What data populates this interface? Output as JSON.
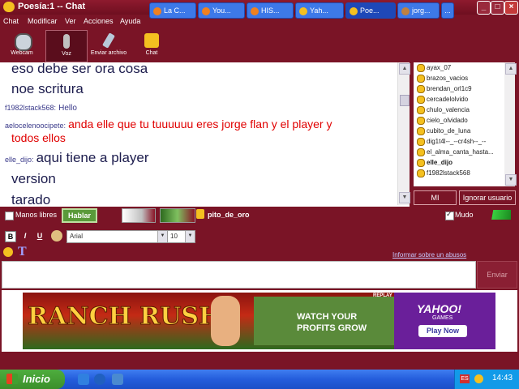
{
  "window": {
    "title": "Poesía:1 -- Chat"
  },
  "menu": [
    "Chat",
    "Modificar",
    "Ver",
    "Acciones",
    "Ayuda"
  ],
  "toolbar": {
    "webcam": "Webcam",
    "voz": "Voz",
    "enviar_archivo": "Enviar archivo",
    "chat": "Chat"
  },
  "chat": {
    "lines": [
      {
        "text": "eso debe ser ora cosa"
      },
      {
        "text": "noe scritura"
      },
      {
        "nick": "f1982lstack568:",
        "text": "Hello"
      },
      {
        "nick": "aelocelenoocipete:",
        "text": "anda elle que tu tuuuuuu eres jorge flan y el player y",
        "text2": "todos ellos"
      },
      {
        "nick": "elle_dijo:",
        "text": "aqui tiene a player"
      },
      {
        "text": "version"
      },
      {
        "text": "tarado"
      }
    ]
  },
  "users": [
    "ayax_07",
    "brazos_vacios",
    "brendan_orl1c9",
    "cercadelolvido",
    "chulo_valencia",
    "cielo_olvidado",
    "cubito_de_luna",
    "dig1t4l--_--cr4sh--_--",
    "el_alma_canta_hasta...",
    "elle_dijo",
    "f1982lstack568"
  ],
  "userlist_buttons": {
    "mi": "MI",
    "ignorar": "Ignorar usuario"
  },
  "voice": {
    "manos_libres": "Manos libres",
    "hablar": "Hablar",
    "speaker": "pito_de_oro",
    "mudo": "Mudo"
  },
  "format": {
    "bold": "B",
    "italic": "I",
    "underline": "U",
    "font": "Arial",
    "size": "10",
    "report_link": "Informar sobre un abusos"
  },
  "send": "Enviar",
  "ad": {
    "title": "RANCH RUSH",
    "tagline1": "WATCH YOUR",
    "tagline2": "PROFITS GROW",
    "replay": "REPLAY",
    "yahoo": "YAHOO!",
    "games": "GAMES",
    "play": "Play Now"
  },
  "taskbar": {
    "start": "Inicio",
    "tasks": [
      "La C...",
      "You...",
      "HIS...",
      "Yah...",
      "Poe...",
      "jorg...",
      "..."
    ],
    "lang": "ES",
    "clock": "14:43"
  },
  "colors": {
    "window_bg": "#7a1426",
    "accent_red": "#e00000"
  }
}
